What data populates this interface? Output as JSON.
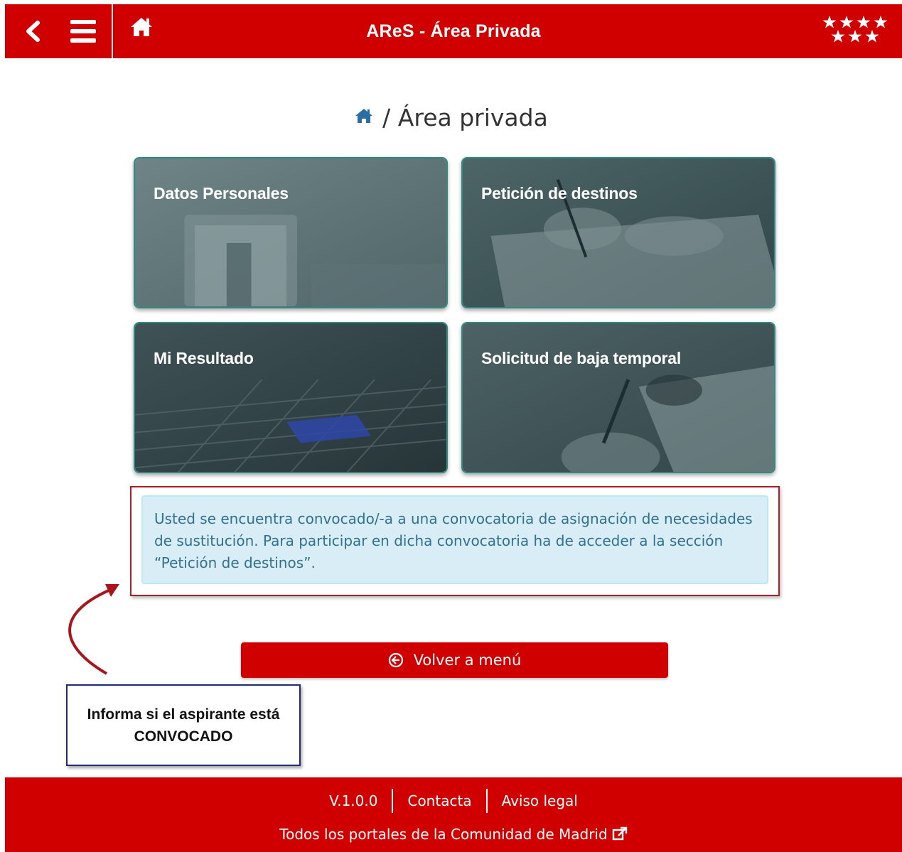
{
  "header": {
    "title": "AReS - Área Privada",
    "back_icon": "chevron-left-icon",
    "menu_icon": "hamburger-menu-icon",
    "home_icon": "home-icon",
    "logo": "comunidad-madrid-stars-logo"
  },
  "breadcrumb": {
    "home_icon": "home-icon",
    "text": "/ Área privada"
  },
  "tiles": [
    {
      "label": "Datos Personales"
    },
    {
      "label": "Petición de destinos"
    },
    {
      "label": "Mi Resultado"
    },
    {
      "label": "Solicitud de baja temporal"
    }
  ],
  "info": {
    "text": "Usted se encuentra convocado/-a a una convocatoria de asignación de necesidades de sustitución. Para participar en dicha convocatoria ha de acceder a la sección “Petición de destinos”."
  },
  "volver": {
    "label": "Volver a menú",
    "icon": "circle-arrow-left-icon"
  },
  "callout": {
    "line1": "Informa si el aspirante está",
    "line2": "CONVOCADO"
  },
  "footer": {
    "version": "V.1.0.0",
    "contacta": "Contacta",
    "aviso": "Aviso legal",
    "portales": "Todos los portales de la Comunidad de Madrid",
    "external_icon": "external-link-icon"
  },
  "colors": {
    "brand_red": "#d10000",
    "info_bg": "#d9edf7",
    "info_text": "#31708f",
    "tile_border": "#2f8a80",
    "callout_border": "#1f2a7a",
    "highlight_border": "#b01c24"
  }
}
